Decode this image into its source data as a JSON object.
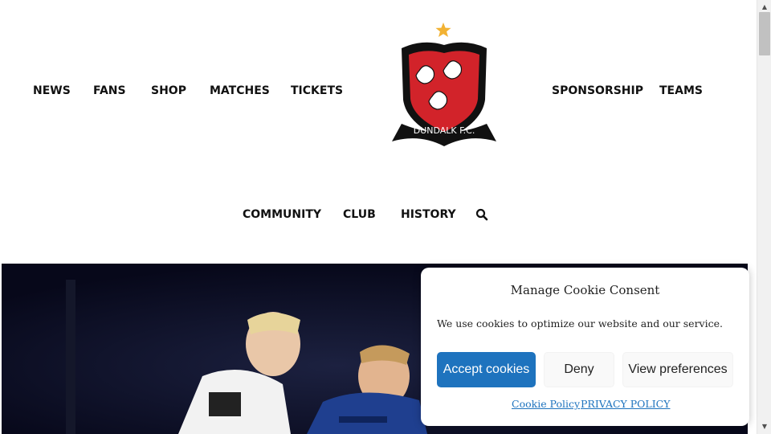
{
  "nav": {
    "left": [
      "NEWS",
      "FANS",
      "SHOP",
      "MATCHES",
      "TICKETS"
    ],
    "right": [
      "SPONSORSHIP",
      "TEAMS"
    ],
    "second_row": [
      "COMMUNITY",
      "CLUB",
      "HISTORY"
    ],
    "search_icon": "search-icon"
  },
  "logo": {
    "text": "DUNDALK F.C.",
    "colors": {
      "shield_red": "#d2232a",
      "outline": "#111111",
      "star": "#f2b233"
    }
  },
  "hero": {
    "background": "#0a0b1a"
  },
  "cookie_consent": {
    "title": "Manage Cookie Consent",
    "message": "We use cookies to optimize our website and our service.",
    "accept_label": "Accept cookies",
    "deny_label": "Deny",
    "preferences_label": "View preferences",
    "cookie_policy_link": "Cookie Policy",
    "privacy_policy_link": "PRIVACY POLICY",
    "accent_color": "#1e73be"
  }
}
